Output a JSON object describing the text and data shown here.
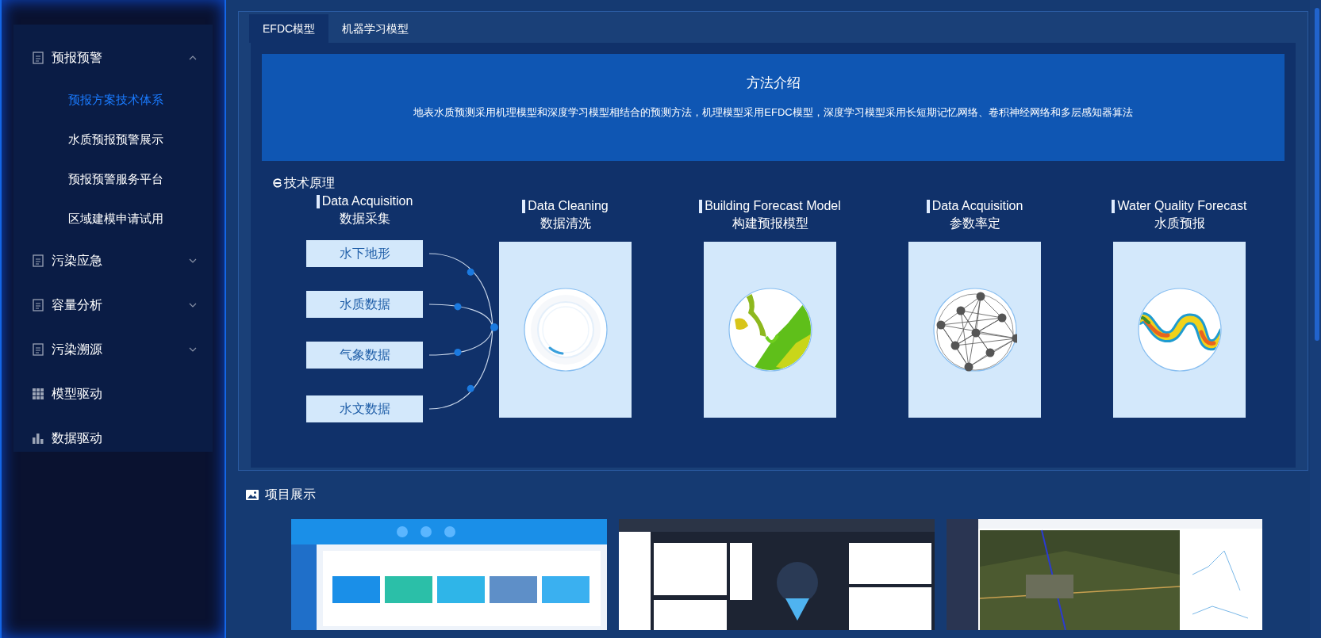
{
  "sidebar": {
    "items": [
      {
        "label": "预报预警",
        "kind": "submenu",
        "expanded": true,
        "children": [
          {
            "label": "预报方案技术体系",
            "selected": true
          },
          {
            "label": "水质预报预警展示",
            "selected": false
          },
          {
            "label": "预报预警服务平台",
            "selected": false
          },
          {
            "label": "区域建模申请试用",
            "selected": false
          }
        ]
      },
      {
        "label": "污染应急",
        "kind": "submenu",
        "expanded": false
      },
      {
        "label": "容量分析",
        "kind": "submenu",
        "expanded": false
      },
      {
        "label": "污染溯源",
        "kind": "submenu",
        "expanded": false
      },
      {
        "label": "模型驱动",
        "kind": "grid"
      },
      {
        "label": "数据驱动",
        "kind": "chart"
      }
    ]
  },
  "tabs": [
    {
      "label": "EFDC模型",
      "selected": true
    },
    {
      "label": "机器学习模型",
      "selected": false
    }
  ],
  "intro": {
    "title": "方法介绍",
    "text": "地表水质预测采用机理模型和深度学习模型相结合的预测方法，机理模型采用EFDC模型，深度学习模型采用长短期记忆网络、卷积神经网络和多层感知器算法"
  },
  "principle": {
    "title": "技术原理",
    "stages": [
      {
        "kind": "sources",
        "title_en": "Data Acquisition",
        "title_zh": "数据采集",
        "sources": [
          "水下地形",
          "水质数据",
          "气象数据",
          "水文数据"
        ]
      },
      {
        "kind": "cleaning",
        "title_en": "Data Cleaning",
        "title_zh": "数据清洗"
      },
      {
        "kind": "model",
        "title_en": "Building Forecast Model",
        "title_zh": "构建预报模型"
      },
      {
        "kind": "network",
        "title_en": "Data Acquisition",
        "title_zh": "参数率定"
      },
      {
        "kind": "forecast",
        "title_en": "Water Quality Forecast",
        "title_zh": "水质预报"
      }
    ]
  },
  "projects": {
    "title": "项目展示"
  }
}
